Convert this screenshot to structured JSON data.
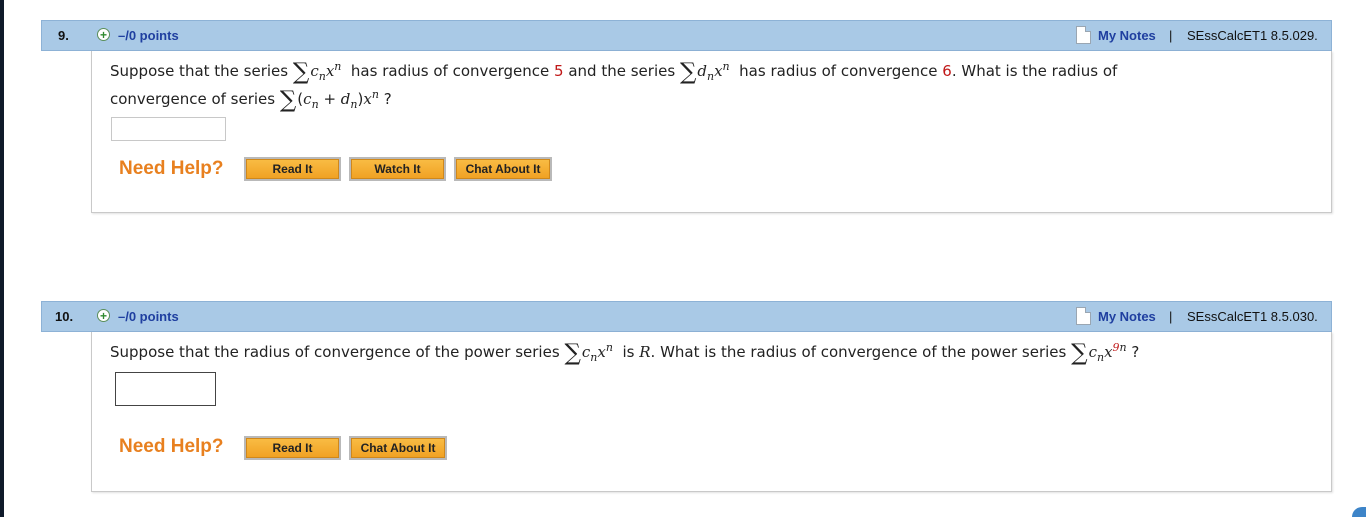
{
  "questions": [
    {
      "number": "9.",
      "points": "–/0 points",
      "my_notes": "My Notes",
      "separator": "|",
      "source": "SEssCalcET1 8.5.029.",
      "text": {
        "p1": "Suppose that the series",
        "sigma": "∑",
        "c": "c",
        "n": "n",
        "x": "x",
        "p2": "has radius of convergence",
        "r1": "5",
        "p3": "and the series",
        "d": "d",
        "p4": "has radius of convergence",
        "r2": "6",
        "p5": ". What is the radius of",
        "line2": "convergence of series",
        "open_paren": "(",
        "plus": "+",
        "close_paren": ")",
        "qmark": "?"
      },
      "answer": {
        "value": "",
        "placeholder": ""
      },
      "help": {
        "label": "Need Help?",
        "buttons": [
          "Read It",
          "Watch It",
          "Chat About It"
        ]
      }
    },
    {
      "number": "10.",
      "points": "–/0 points",
      "my_notes": "My Notes",
      "separator": "|",
      "source": "SEssCalcET1 8.5.030.",
      "text": {
        "p1": "Suppose that the radius of convergence of the power series",
        "sigma": "∑",
        "c": "c",
        "n": "n",
        "x": "x",
        "p2": "is",
        "R": "R",
        "p3": ". What is the radius of convergence of the power series",
        "exp9": "9",
        "qmark": "?"
      },
      "answer": {
        "value": "",
        "placeholder": ""
      },
      "help": {
        "label": "Need Help?",
        "buttons": [
          "Read It",
          "Chat About It"
        ]
      }
    }
  ],
  "colors": {
    "header_bg": "#a9c9e6",
    "link_blue": "#1f3fa0",
    "need_help_orange": "#e8801f",
    "button_orange": "#f0a022",
    "value_red": "#c01818",
    "plus_green": "#2f8a2f"
  },
  "icons": [
    "plus-icon",
    "notes-icon",
    "sigma-icon"
  ]
}
